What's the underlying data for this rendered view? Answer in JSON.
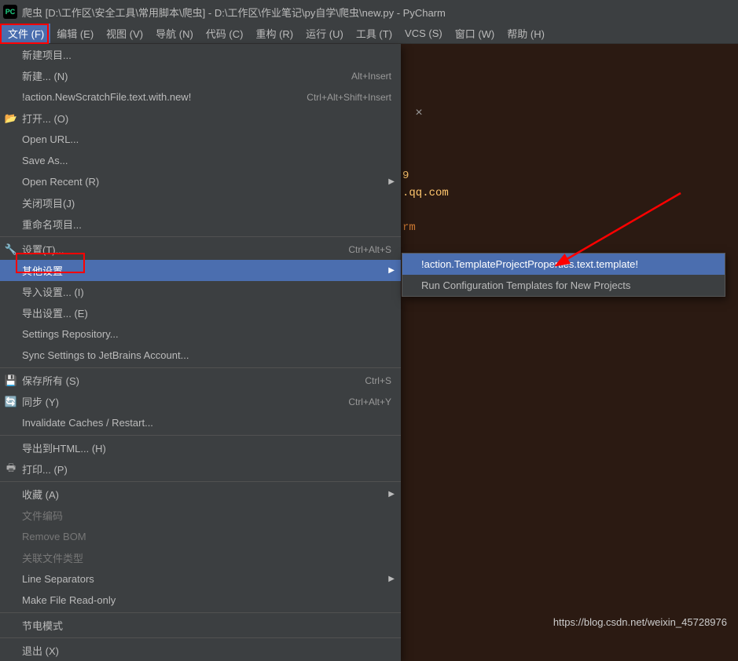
{
  "title": "爬虫 [D:\\工作区\\安全工具\\常用脚本\\爬虫] - D:\\工作区\\作业笔记\\py自学\\爬虫\\new.py - PyCharm",
  "menubar": {
    "file": "文件 (F)",
    "edit": "编辑 (E)",
    "view": "视图 (V)",
    "navigate": "导航 (N)",
    "code": "代码 (C)",
    "refactor": "重构 (R)",
    "run": "运行 (U)",
    "tools": "工具 (T)",
    "vcs": "VCS (S)",
    "window": "窗口 (W)",
    "help": "帮助 (H)"
  },
  "dropdown": {
    "new_project": "新建项目...",
    "new": "新建... (N)",
    "new_sc": "Alt+Insert",
    "scratch": "!action.NewScratchFile.text.with.new!",
    "scratch_sc": "Ctrl+Alt+Shift+Insert",
    "open": "打开... (O)",
    "open_url": "Open URL...",
    "save_as": "Save As...",
    "open_recent": "Open Recent (R)",
    "close_project": "关闭项目(J)",
    "rename_project": "重命名项目...",
    "settings": "设置(T)...",
    "settings_sc": "Ctrl+Alt+S",
    "other_settings": "其他设置",
    "import_settings": "导入设置... (I)",
    "export_settings": "导出设置... (E)",
    "settings_repo": "Settings Repository...",
    "sync_settings": "Sync Settings to JetBrains Account...",
    "save_all": "保存所有 (S)",
    "save_all_sc": "Ctrl+S",
    "sync": "同步 (Y)",
    "sync_sc": "Ctrl+Alt+Y",
    "invalidate": "Invalidate Caches / Restart...",
    "export_html": "导出到HTML... (H)",
    "print": "打印... (P)",
    "favorites": "收藏 (A)",
    "file_encoding": "文件编码",
    "remove_bom": "Remove BOM",
    "assoc_types": "关联文件类型",
    "line_sep": "Line Separators",
    "readonly": "Make File Read-only",
    "power": "节电模式",
    "exit": "退出 (X)"
  },
  "submenu": {
    "template_props": "!action.TemplateProjectProperties.text.template!",
    "run_config": "Run Configuration Templates for New Projects"
  },
  "code": {
    "line1": "9",
    "line2": ".qq.com",
    "line3": "rm"
  },
  "watermark": "https://blog.csdn.net/weixin_45728976",
  "tab_close": "×"
}
